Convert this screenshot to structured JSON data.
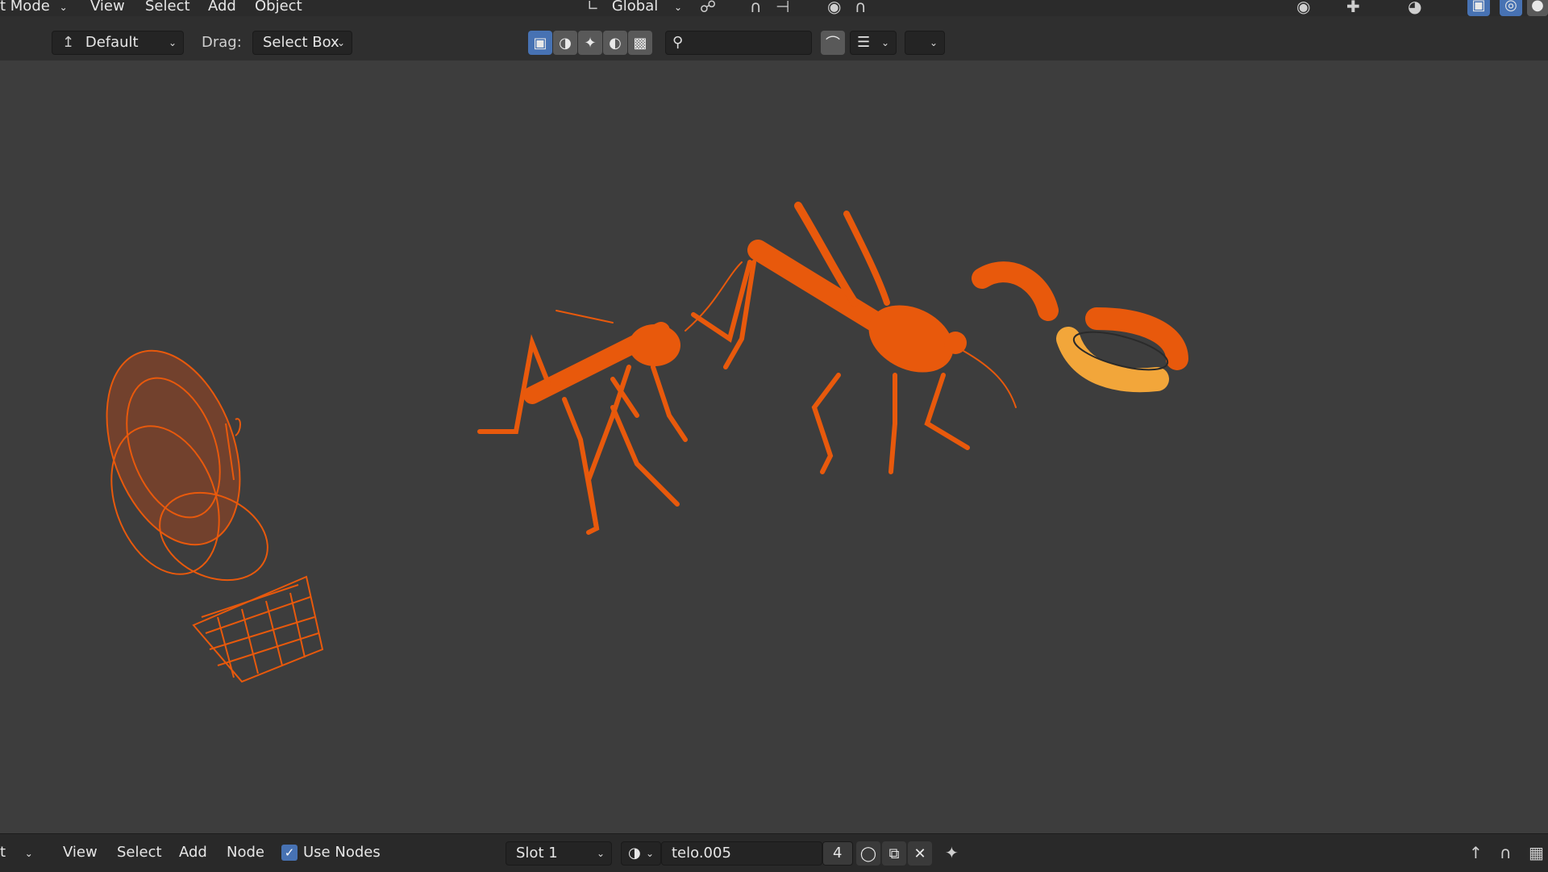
{
  "header": {
    "mode": "t Mode",
    "menus": [
      "View",
      "Select",
      "Add",
      "Object"
    ],
    "transform_orientation": "Global"
  },
  "toolbar": {
    "transform_pivot_label": "Default",
    "drag_label": "Drag:",
    "drag_value": "Select Box",
    "search_value": ""
  },
  "footer": {
    "editor_type": "t",
    "menus": [
      "View",
      "Select",
      "Add",
      "Node"
    ],
    "use_nodes_label": "Use Nodes",
    "use_nodes_checked": true,
    "slot_label": "Slot 1",
    "material_name": "telo.005",
    "user_count": "4"
  },
  "colors": {
    "selected_orange": "#e8590c",
    "active_yellow": "#f2a63a",
    "accent_blue": "#4772b3"
  }
}
